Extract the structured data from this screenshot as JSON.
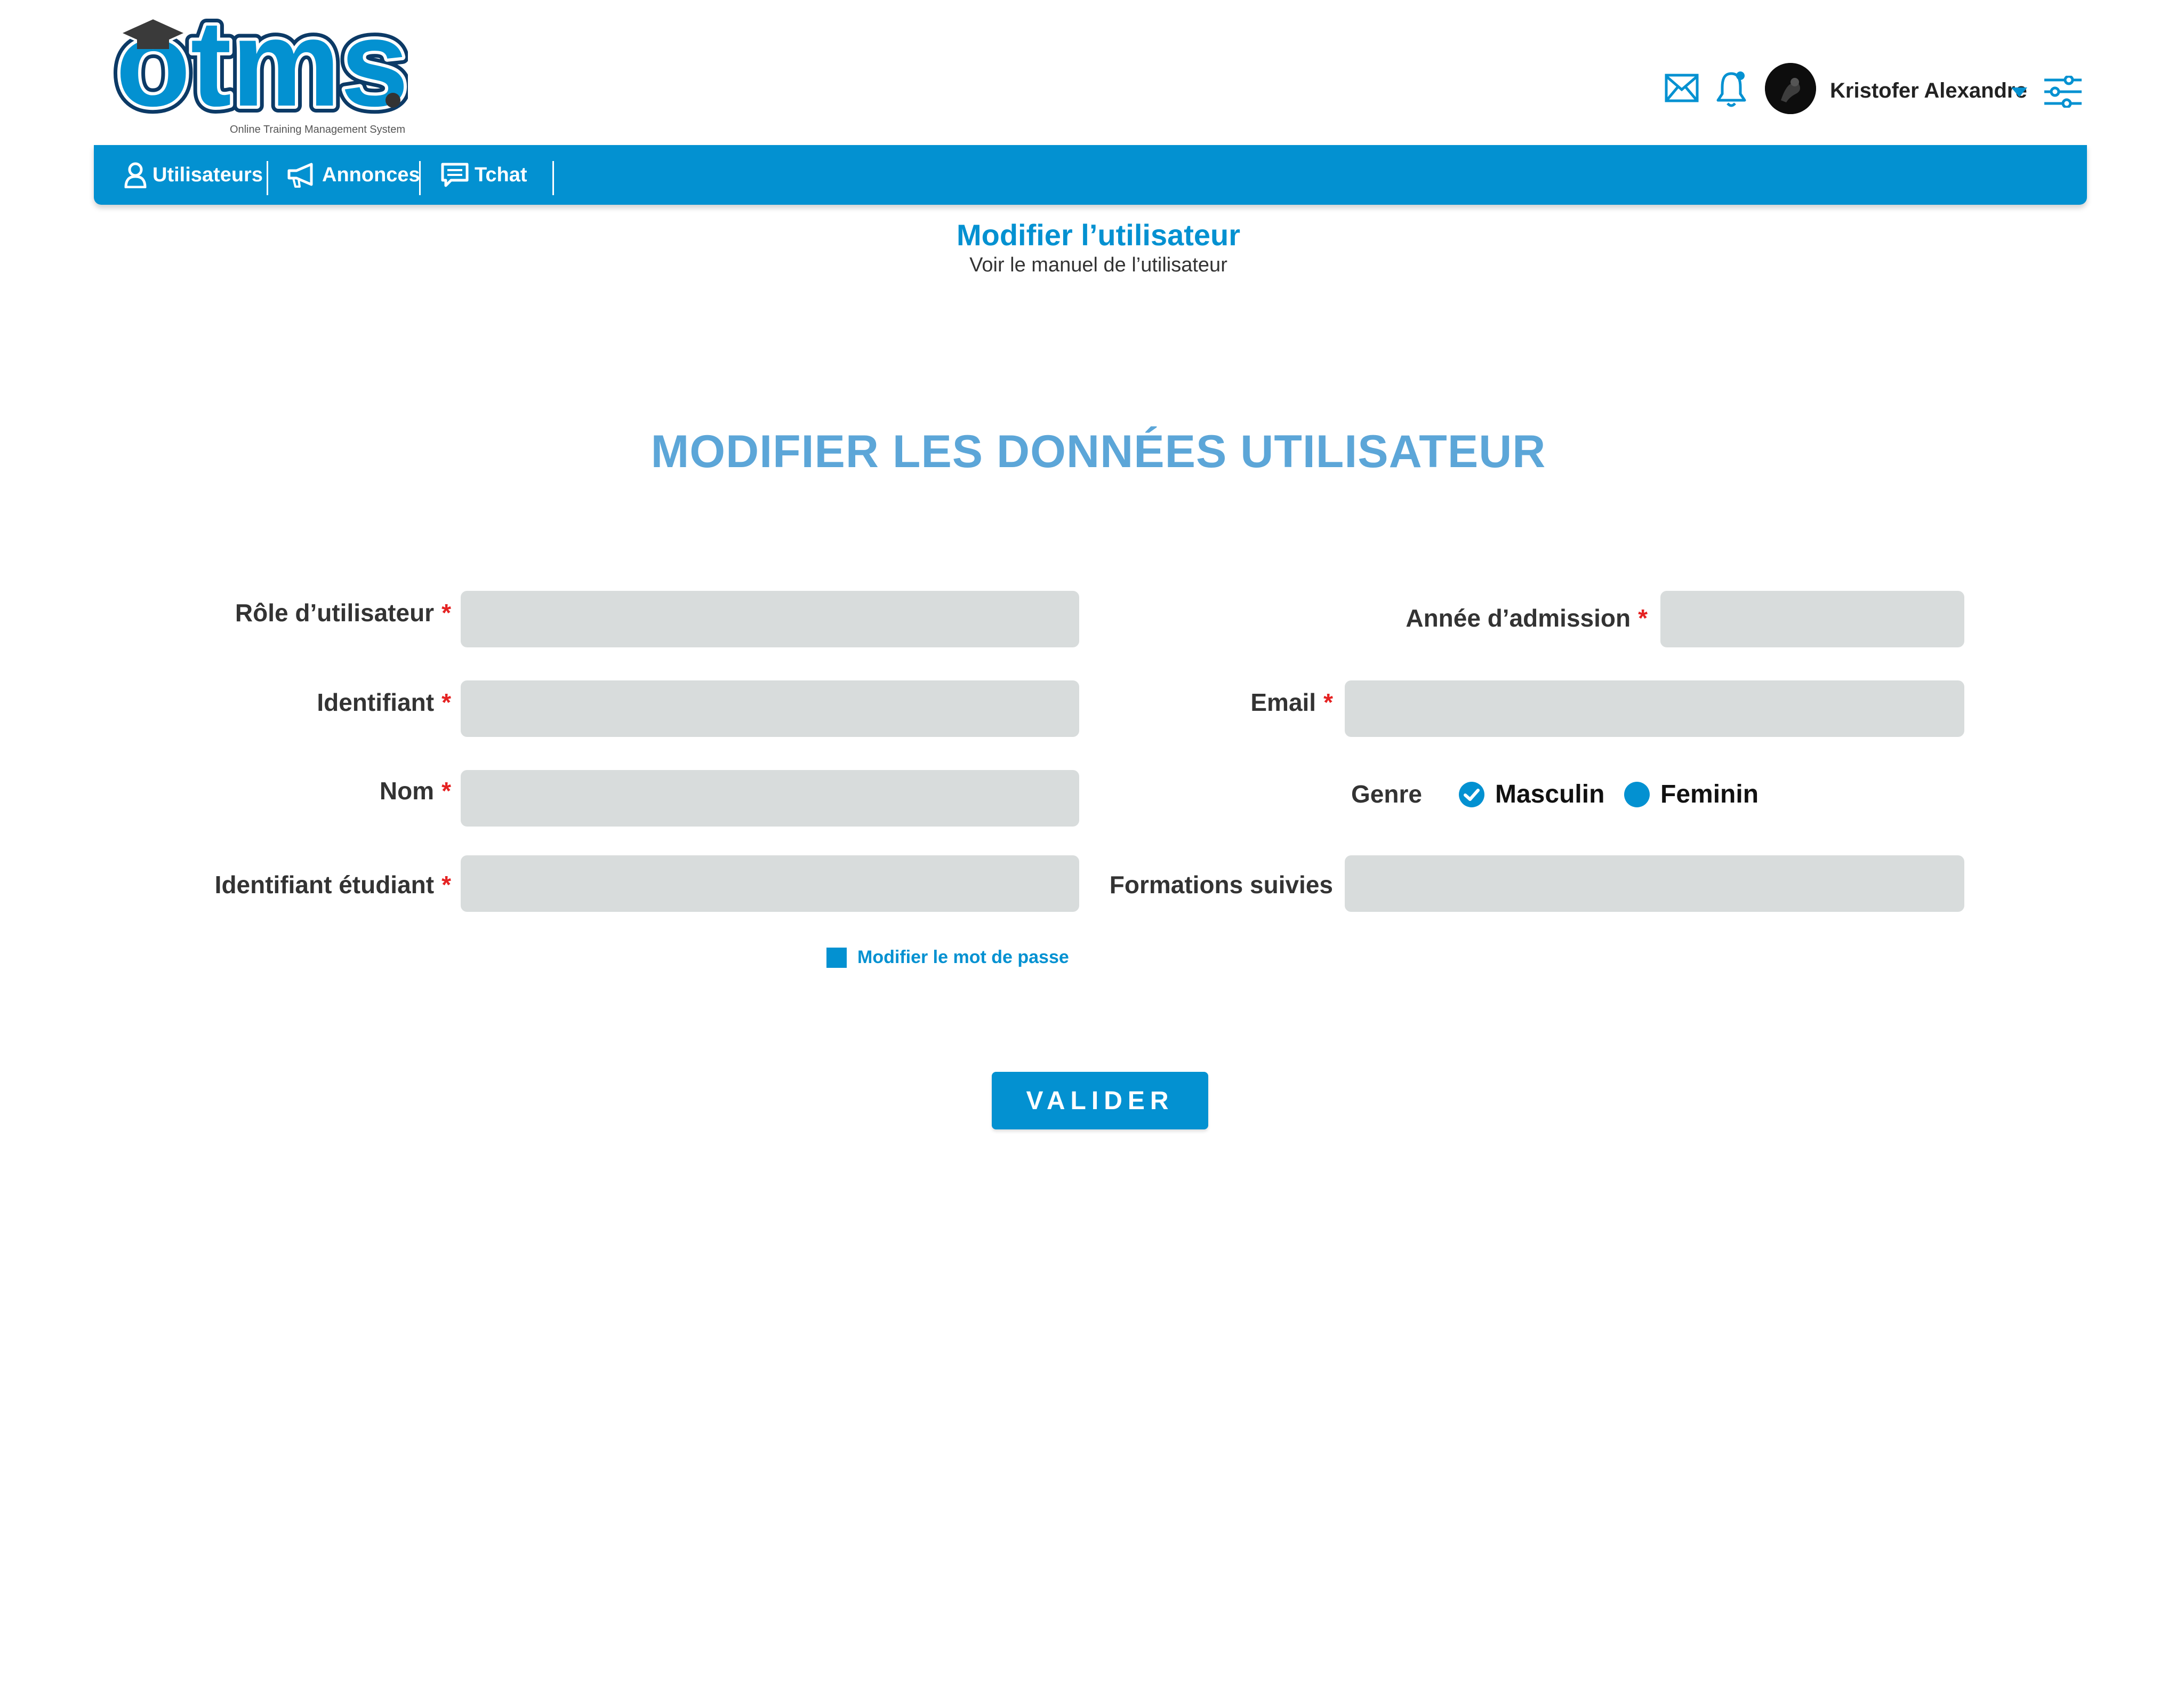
{
  "brand": {
    "logo_text": "otms",
    "tagline": "Online Training Management System"
  },
  "header": {
    "user_name": "Kristofer Alexandre",
    "icons": [
      "mail-icon",
      "bell-icon",
      "caret-down-icon",
      "sliders-icon"
    ]
  },
  "nav": {
    "items": [
      {
        "label": "Utilisateurs",
        "icon": "user-icon"
      },
      {
        "label": "Annonces",
        "icon": "megaphone-icon"
      },
      {
        "label": "Tchat",
        "icon": "chat-icon"
      }
    ]
  },
  "page": {
    "title": "Modifier l’utilisateur",
    "subtitle": "Voir le manuel de l’utilisateur"
  },
  "form": {
    "heading": "MODIFIER LES DONNÉES UTILISATEUR",
    "required_marker": "*",
    "fields": {
      "role": {
        "label": "Rôle d’utilisateur",
        "value": ""
      },
      "identifiant": {
        "label": "Identifiant",
        "value": ""
      },
      "nom": {
        "label": "Nom",
        "value": ""
      },
      "identifiant_etudiant": {
        "label": "Identifiant étudiant",
        "value": ""
      },
      "annee_admission": {
        "label": "Année d’admission",
        "value": ""
      },
      "email": {
        "label": "Email",
        "value": ""
      },
      "formations": {
        "label": "Formations suivies",
        "value": ""
      }
    },
    "genre": {
      "label": "Genre",
      "options": [
        "Masculin",
        "Feminin"
      ],
      "selected": "Masculin"
    },
    "change_password_label": "Modifier le mot de passe",
    "submit_label": "VALIDER"
  },
  "colors": {
    "primary": "#0391d1",
    "heading": "#5ca6d8",
    "field_bg": "#d8dcdc",
    "required": "#e52222"
  }
}
